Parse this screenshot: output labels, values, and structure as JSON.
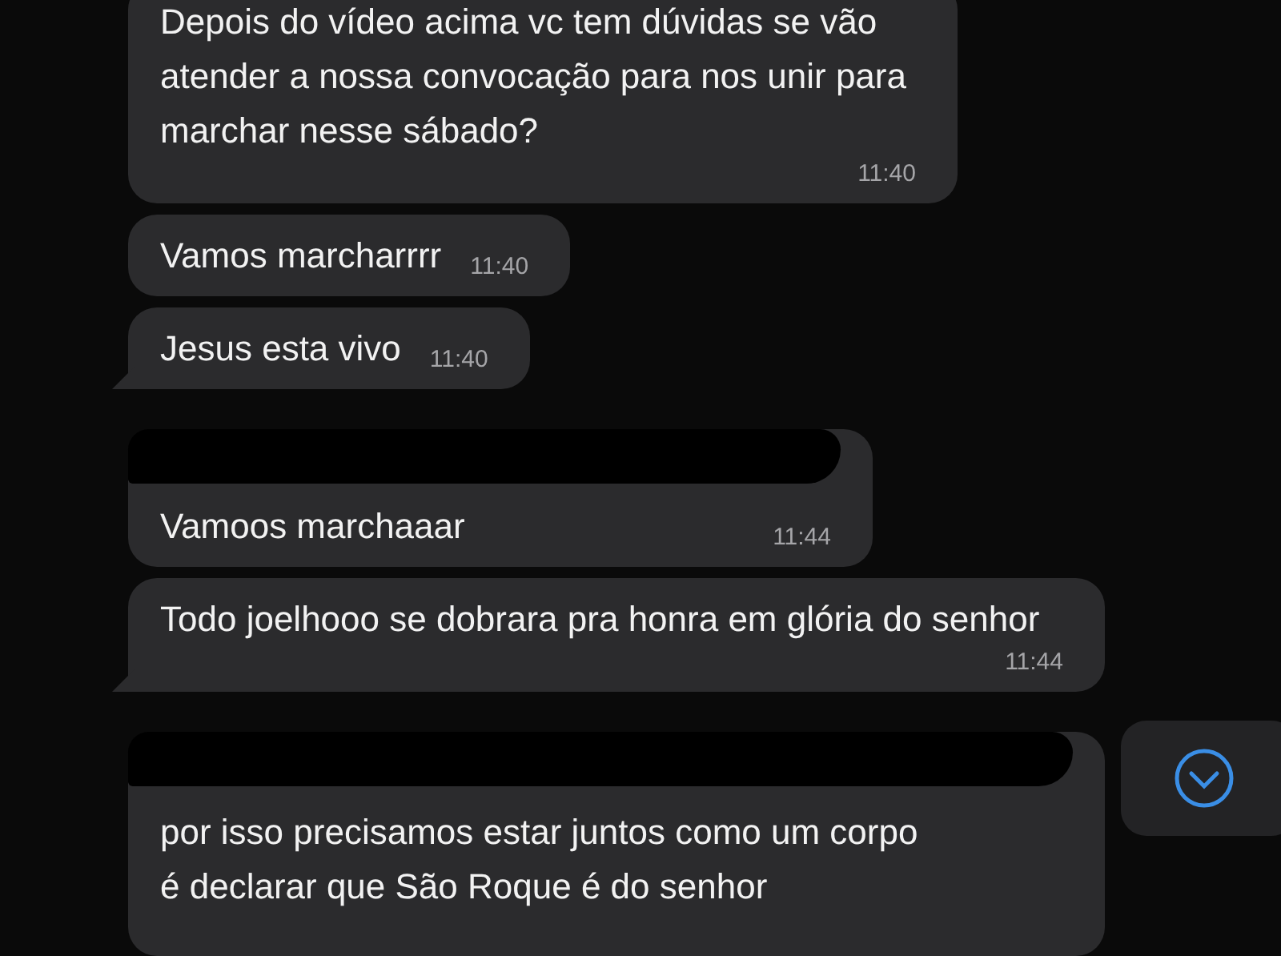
{
  "messages": [
    {
      "text": "Depois do vídeo acima vc tem dúvidas se vão atender a nossa convocação para nos unir para marchar nesse sábado?",
      "time": "11:40",
      "tail": false,
      "redacted": false
    },
    {
      "text": "Vamos marcharrrr",
      "time": "11:40",
      "tail": false,
      "redacted": false
    },
    {
      "text": "Jesus esta vivo",
      "time": "11:40",
      "tail": true,
      "redacted": false
    },
    {
      "text": "Vamoos marchaaar",
      "time": "11:44",
      "tail": false,
      "redacted": true
    },
    {
      "text": "Todo joelhooo se dobrara pra honra em glória do senhor",
      "time": "11:44",
      "tail": true,
      "redacted": false
    },
    {
      "text": "por isso precisamos estar juntos como um corpo é declarar que São Roque é do senhor",
      "tail": false,
      "redacted": true
    }
  ],
  "scroll_down_button": {
    "visible": true
  }
}
